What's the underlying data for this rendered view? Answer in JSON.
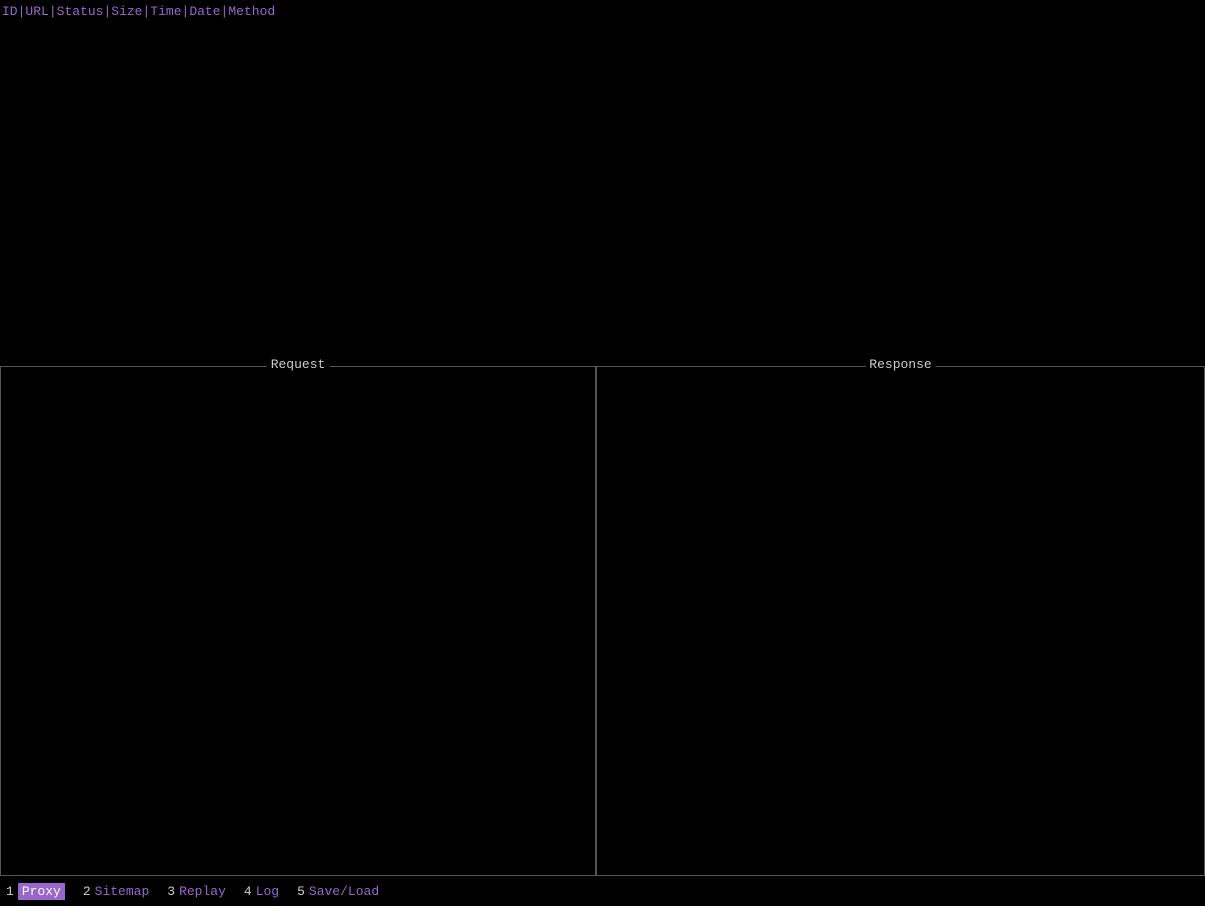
{
  "header": {
    "columns": [
      {
        "id": "col-id",
        "label": "ID"
      },
      {
        "id": "col-url",
        "label": "URL"
      },
      {
        "id": "col-status",
        "label": "Status"
      },
      {
        "id": "col-size",
        "label": "Size"
      },
      {
        "id": "col-time",
        "label": "Time"
      },
      {
        "id": "col-date",
        "label": "Date"
      },
      {
        "id": "col-method",
        "label": "Method"
      }
    ]
  },
  "panels": {
    "request": {
      "label": "Request"
    },
    "response": {
      "label": "Response"
    }
  },
  "bottomNav": {
    "items": [
      {
        "number": "1",
        "label": "Proxy",
        "active": true
      },
      {
        "number": "2",
        "label": "Sitemap",
        "active": false
      },
      {
        "number": "3",
        "label": "Replay",
        "active": false
      },
      {
        "number": "4",
        "label": "Log",
        "active": false
      },
      {
        "number": "5",
        "label": "Save/Load",
        "active": false
      }
    ]
  }
}
